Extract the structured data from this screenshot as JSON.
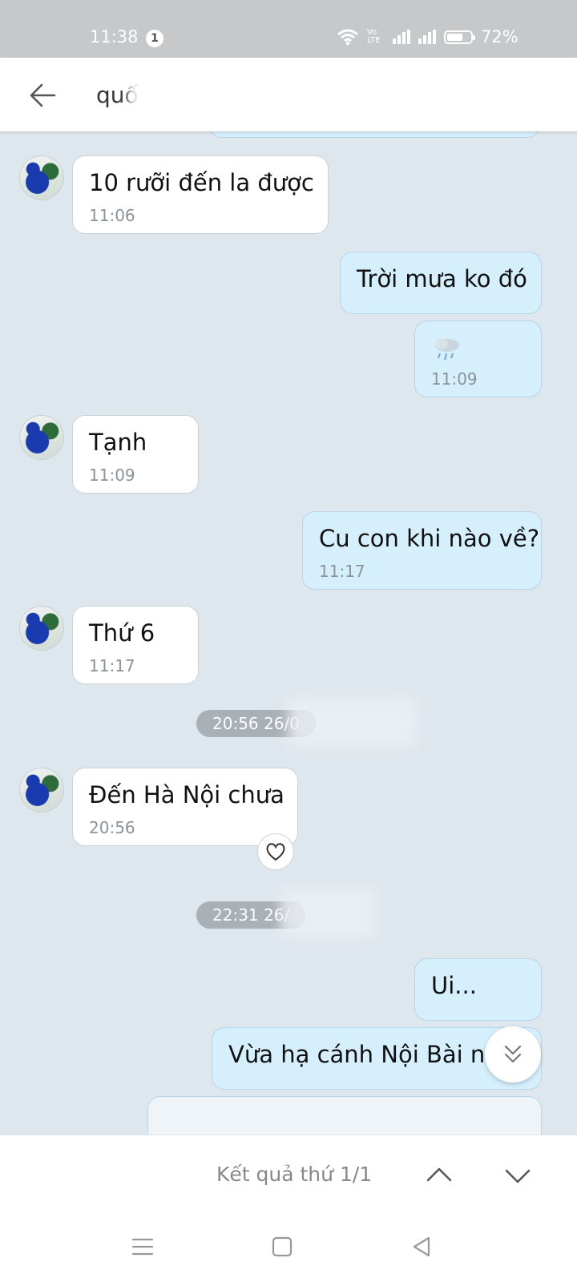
{
  "status_bar": {
    "time": "11:38",
    "notification_count": "1",
    "volte_label": "Vo LTE",
    "battery_level": 0.72,
    "battery_text": "72%"
  },
  "search": {
    "query": "quố"
  },
  "messages": [
    {
      "direction": "in",
      "text": "10 rưỡi đến la được",
      "time": "11:06"
    },
    {
      "direction": "out",
      "text": "Trời mưa ko đó",
      "time": ""
    },
    {
      "direction": "out",
      "text": "rain-cloud-emoji",
      "time": "11:09"
    },
    {
      "direction": "in",
      "text": "Tạnh",
      "time": "11:09"
    },
    {
      "direction": "out",
      "text": "Cu con khi nào về?",
      "time": "11:17"
    },
    {
      "direction": "in",
      "text": "Thứ 6",
      "time": "11:17"
    },
    {
      "direction": "in",
      "text": "Đến Hà Nội chưa",
      "time": "20:56"
    },
    {
      "direction": "out",
      "text": "Ui...",
      "time": ""
    },
    {
      "direction": "out",
      "text": "Vừa hạ cánh Nội Bài nà",
      "time": ""
    }
  ],
  "date_separators": [
    "20:56 26/0",
    "22:31 26/"
  ],
  "result_bar": {
    "text": "Kết quả thứ 1/1"
  },
  "colors": {
    "chat_background": "#dfe7ee",
    "outgoing_bubble": "#d6effd",
    "incoming_bubble": "#ffffff",
    "status_bar": "#c7c8ca"
  }
}
